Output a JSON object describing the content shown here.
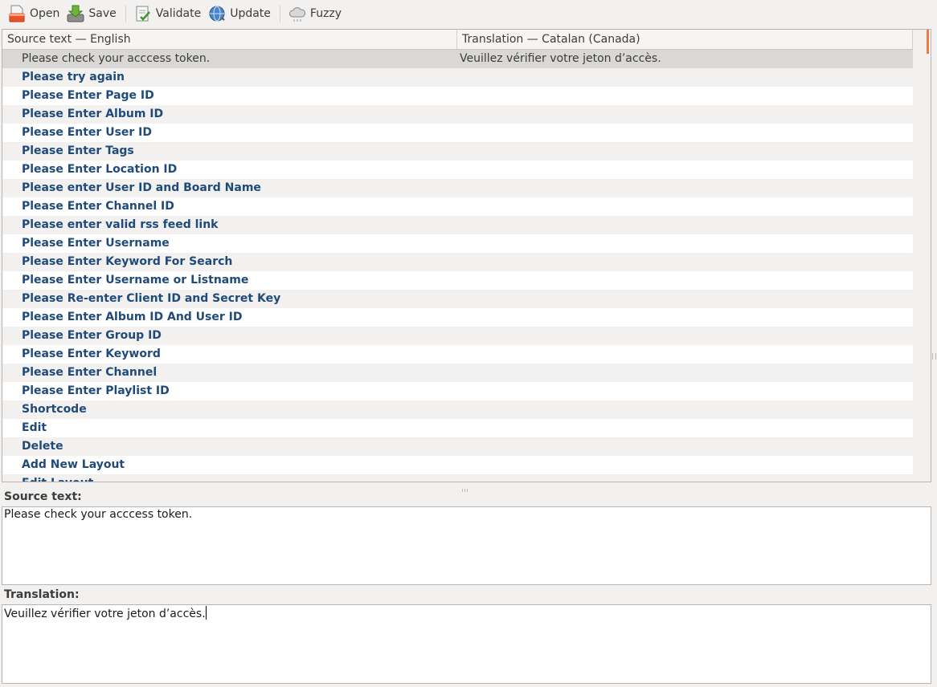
{
  "toolbar": {
    "open_label": "Open",
    "save_label": "Save",
    "validate_label": "Validate",
    "update_label": "Update",
    "fuzzy_label": "Fuzzy"
  },
  "list": {
    "columns": {
      "source": "Source text — English",
      "translation": "Translation — Catalan (Canada)"
    },
    "rows": [
      {
        "source": "Please check your acccess token.",
        "translation": "Veuillez vérifier votre jeton d’accès."
      },
      {
        "source": "Please try again",
        "translation": ""
      },
      {
        "source": "Please Enter Page ID",
        "translation": ""
      },
      {
        "source": "Please Enter Album ID",
        "translation": ""
      },
      {
        "source": "Please Enter User ID",
        "translation": ""
      },
      {
        "source": "Please Enter Tags",
        "translation": ""
      },
      {
        "source": "Please Enter Location ID",
        "translation": ""
      },
      {
        "source": "Please enter User ID and Board Name",
        "translation": ""
      },
      {
        "source": "Please Enter Channel ID",
        "translation": ""
      },
      {
        "source": "Please enter valid rss feed link",
        "translation": ""
      },
      {
        "source": "Please Enter Username",
        "translation": ""
      },
      {
        "source": "Please Enter Keyword For Search",
        "translation": ""
      },
      {
        "source": "Please Enter Username or Listname",
        "translation": ""
      },
      {
        "source": "Please Re-enter Client ID and Secret Key",
        "translation": ""
      },
      {
        "source": "Please Enter Album ID And User ID",
        "translation": ""
      },
      {
        "source": "Please Enter Group ID",
        "translation": ""
      },
      {
        "source": "Please Enter Keyword",
        "translation": ""
      },
      {
        "source": "Please Enter Channel",
        "translation": ""
      },
      {
        "source": "Please Enter Playlist ID",
        "translation": ""
      },
      {
        "source": "Shortcode",
        "translation": ""
      },
      {
        "source": "Edit",
        "translation": ""
      },
      {
        "source": "Delete",
        "translation": ""
      },
      {
        "source": "Add New Layout",
        "translation": ""
      },
      {
        "source": "Edit Layout",
        "translation": ""
      }
    ]
  },
  "source_panel": {
    "label": "Source text:",
    "text": "Please check your acccess token."
  },
  "translation_panel": {
    "label": "Translation:",
    "text": "Veuillez vérifier votre jeton d’accès."
  },
  "colors": {
    "untranslated_text": "#1f4a7a",
    "selected_row": "#d9d8d6",
    "scroll_accent": "#f07746"
  }
}
